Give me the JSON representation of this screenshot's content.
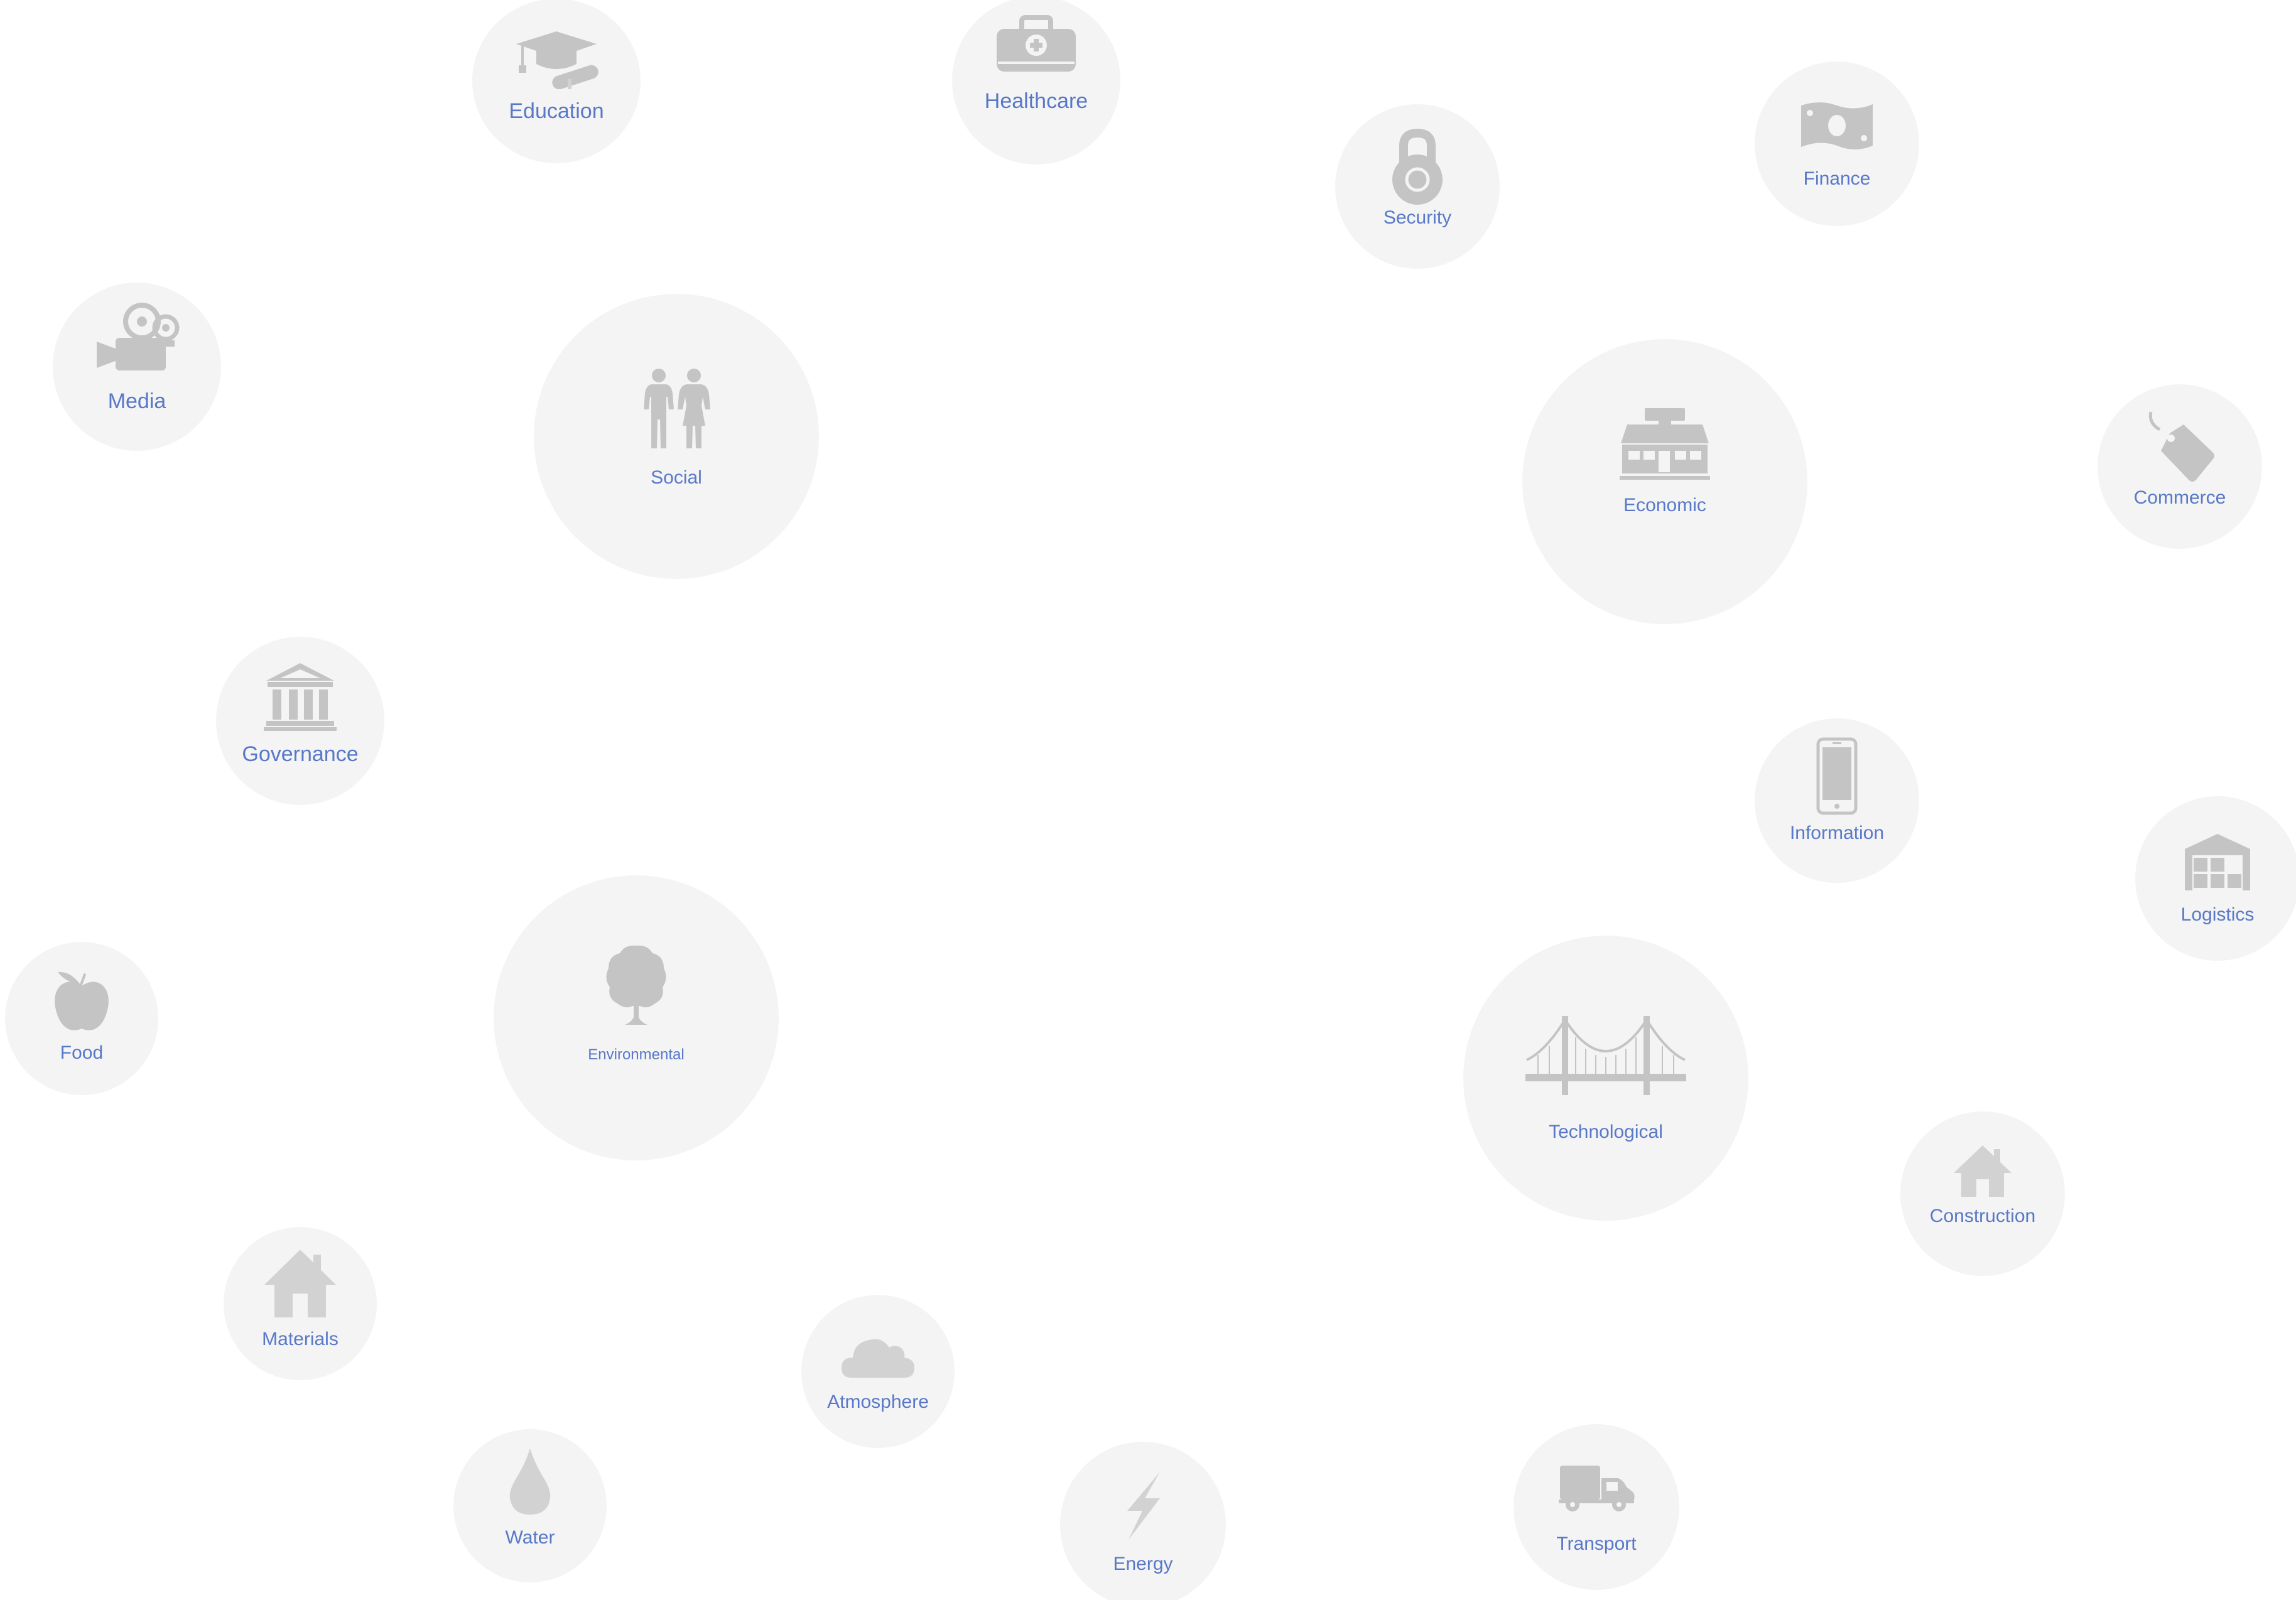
{
  "diagram": {
    "background": "#ffffff",
    "node_fill": "#f4f4f4",
    "icon_color": "#c4c4c4",
    "label_color": "#5878c8",
    "nodes": {
      "education": {
        "label": "Education",
        "icon": "graduation-cap-icon"
      },
      "healthcare": {
        "label": "Healthcare",
        "icon": "medical-bag-icon"
      },
      "security": {
        "label": "Security",
        "icon": "padlock-icon"
      },
      "finance": {
        "label": "Finance",
        "icon": "banknote-icon"
      },
      "media": {
        "label": "Media",
        "icon": "film-camera-icon"
      },
      "social": {
        "label": "Social",
        "icon": "people-icon"
      },
      "economic": {
        "label": "Economic",
        "icon": "storefront-icon"
      },
      "commerce": {
        "label": "Commerce",
        "icon": "price-tag-icon"
      },
      "governance": {
        "label": "Governance",
        "icon": "government-building-icon"
      },
      "information": {
        "label": "Information",
        "icon": "smartphone-icon"
      },
      "logistics": {
        "label": "Logistics",
        "icon": "warehouse-icon"
      },
      "food": {
        "label": "Food",
        "icon": "apple-icon"
      },
      "environmental": {
        "label": "Environmental",
        "icon": "tree-icon"
      },
      "technological": {
        "label": "Technological",
        "icon": "bridge-icon"
      },
      "construction": {
        "label": "Construction",
        "icon": "house-icon"
      },
      "materials": {
        "label": "Materials",
        "icon": "house-icon"
      },
      "atmosphere": {
        "label": "Atmosphere",
        "icon": "cloud-icon"
      },
      "water": {
        "label": "Water",
        "icon": "water-drop-icon"
      },
      "energy": {
        "label": "Energy",
        "icon": "lightning-bolt-icon"
      },
      "transport": {
        "label": "Transport",
        "icon": "delivery-truck-icon"
      }
    }
  }
}
